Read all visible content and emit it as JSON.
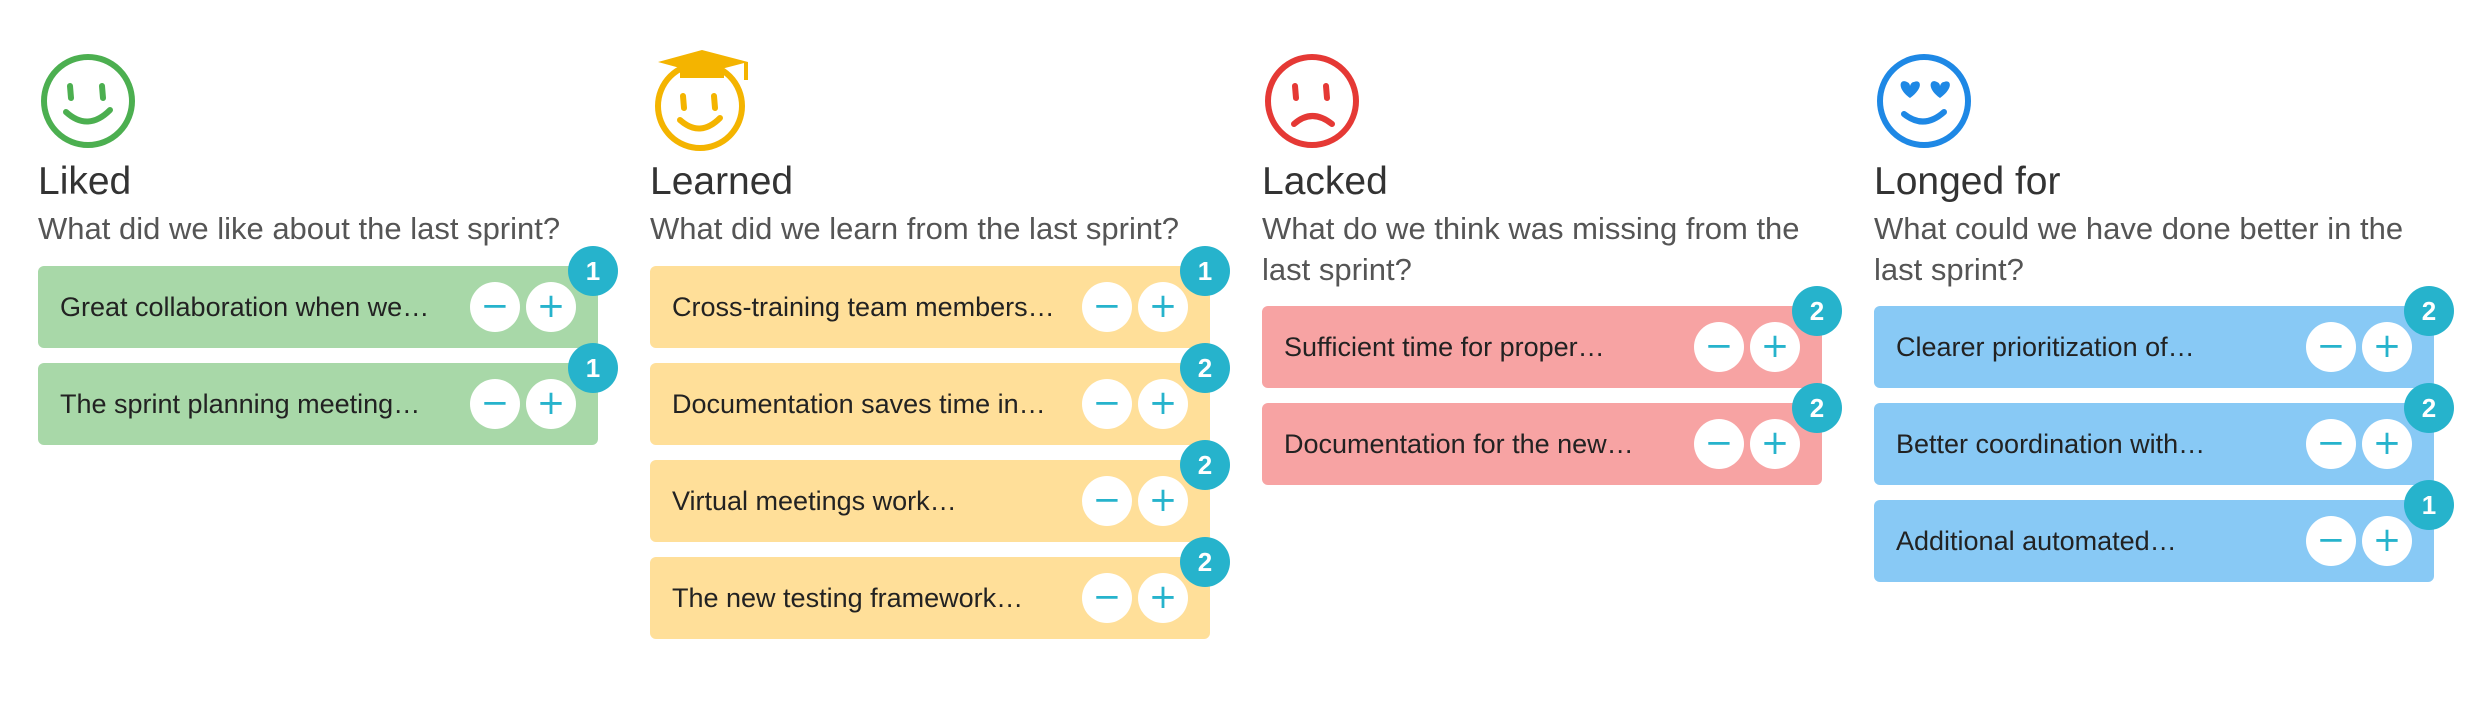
{
  "colors": {
    "liked_card": "#a8d8a8",
    "learned_card": "#ffdf99",
    "lacked_card": "#f7a3a3",
    "longed_card": "#88c9f5",
    "liked_icon": "#4caf50",
    "learned_icon": "#f4b400",
    "lacked_icon": "#e53935",
    "longed_icon": "#1e88e5",
    "vote_accent": "#26b3cc"
  },
  "vote_controls": {
    "minus": "−",
    "plus": "+"
  },
  "columns": [
    {
      "key": "liked",
      "icon": "smiley-face-icon",
      "title": "Liked",
      "question": "What did we like about the last sprint?",
      "cards": [
        {
          "text": "Great collaboration when we…",
          "votes": "1"
        },
        {
          "text": "The sprint planning meeting…",
          "votes": "1"
        }
      ]
    },
    {
      "key": "learned",
      "icon": "graduate-face-icon",
      "title": "Learned",
      "question": "What did we learn from the last sprint?",
      "cards": [
        {
          "text": "Cross-training team members…",
          "votes": "1"
        },
        {
          "text": "Documentation saves time in…",
          "votes": "2"
        },
        {
          "text": "Virtual meetings work…",
          "votes": "2"
        },
        {
          "text": "The new testing framework…",
          "votes": "2"
        }
      ]
    },
    {
      "key": "lacked",
      "icon": "sad-face-icon",
      "title": "Lacked",
      "question": "What do we think was missing from the last sprint?",
      "cards": [
        {
          "text": "Sufficient time for proper…",
          "votes": "2"
        },
        {
          "text": "Documentation for the new…",
          "votes": "2"
        }
      ]
    },
    {
      "key": "longed",
      "icon": "heart-eyes-face-icon",
      "title": "Longed for",
      "question": "What could we have done better in the last sprint?",
      "cards": [
        {
          "text": "Clearer prioritization of…",
          "votes": "2"
        },
        {
          "text": "Better coordination with…",
          "votes": "2"
        },
        {
          "text": "Additional automated…",
          "votes": "1"
        }
      ]
    }
  ]
}
